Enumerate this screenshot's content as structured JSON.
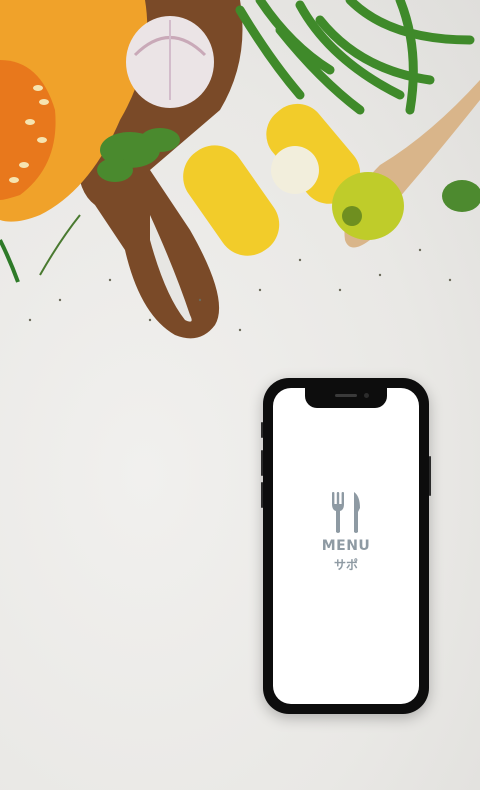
{
  "splash": {
    "logo_icon": "fork-knife-icon",
    "title": "MENU",
    "subtitle": "サポ",
    "accent_color": "#8e9aa3"
  },
  "background": {
    "description_icon": "vegetables-photo",
    "surface_color": "#ecebe8"
  }
}
